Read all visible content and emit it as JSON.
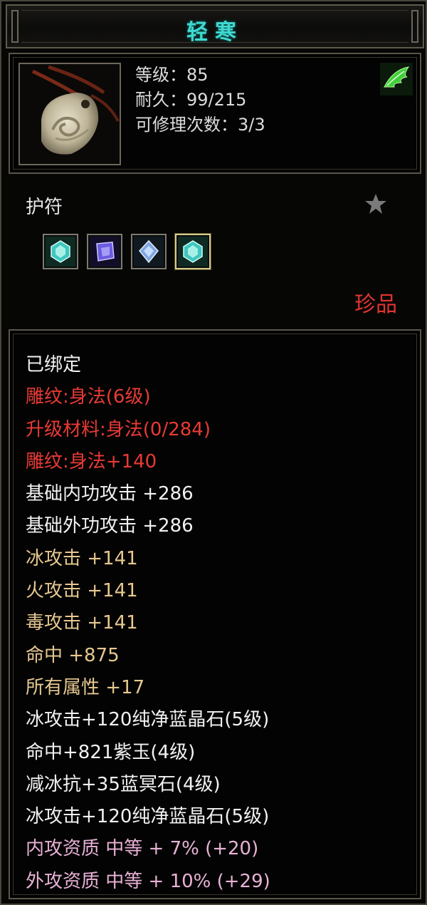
{
  "item": {
    "name": "轻寒",
    "level_line": "等级：85",
    "durability_line": "耐久：99/215",
    "repairs_line": "可修理次数：3/3",
    "type": "护符",
    "rarity": "珍品"
  },
  "icons": {
    "item_icon": "jade-pendant-icon",
    "badge_icon": "green-wing-icon",
    "favorite_icon": "star-icon"
  },
  "gems": [
    {
      "name": "cyan-gem-icon",
      "color": "#3fc6c0"
    },
    {
      "name": "purple-gem-icon",
      "color": "#6a5ce0"
    },
    {
      "name": "blue-gem-icon",
      "color": "#7fa6e0"
    },
    {
      "name": "cyan-gem-icon",
      "color": "#3fc6c0",
      "active": true
    }
  ],
  "attributes": [
    {
      "text": "已绑定",
      "tone": "white"
    },
    {
      "text": "雕纹:身法(6级)",
      "tone": "red"
    },
    {
      "text": "升级材料:身法(0/284)",
      "tone": "red"
    },
    {
      "text": "雕纹:身法+140",
      "tone": "red"
    },
    {
      "text": "基础内功攻击  +286",
      "tone": "white"
    },
    {
      "text": "基础外功攻击  +286",
      "tone": "white"
    },
    {
      "text": "冰攻击  +141",
      "tone": "yellow"
    },
    {
      "text": "火攻击  +141",
      "tone": "yellow"
    },
    {
      "text": "毒攻击  +141",
      "tone": "yellow"
    },
    {
      "text": "命中  +875",
      "tone": "yellow"
    },
    {
      "text": "所有属性  +17",
      "tone": "yellow"
    },
    {
      "text": "冰攻击+120纯净蓝晶石(5级)",
      "tone": "white"
    },
    {
      "text": "命中+821紫玉(4级)",
      "tone": "white"
    },
    {
      "text": "减冰抗+35蓝冥石(4级)",
      "tone": "white"
    },
    {
      "text": "冰攻击+120纯净蓝晶石(5级)",
      "tone": "white"
    },
    {
      "text": "内攻资质  中等  + 7% (+20)",
      "tone": "pink"
    },
    {
      "text": "外攻资质  中等  + 10% (+29)",
      "tone": "pink"
    }
  ],
  "colors": {
    "title": "#40d8d0",
    "white": "#f2f2f2",
    "red": "#e83a34",
    "yellow": "#e6c890",
    "pink": "#e8b2d6",
    "rarity": "#e03530"
  }
}
